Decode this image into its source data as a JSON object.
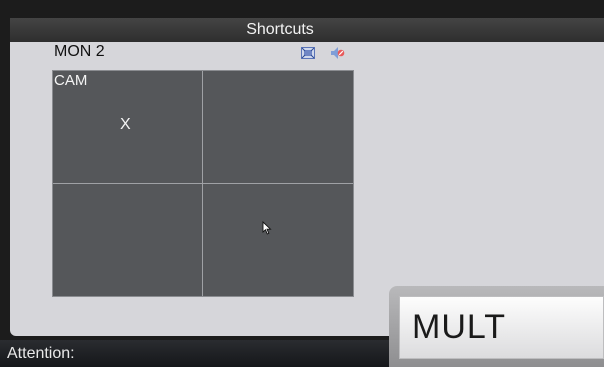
{
  "window": {
    "title": "Shortcuts"
  },
  "monitor": {
    "label": "MON 2"
  },
  "icons": {
    "fullscreen": "fullscreen-icon",
    "mute": "mute-icon",
    "cursor": "pointer-cursor-icon"
  },
  "grid": {
    "cells": [
      {
        "label": "CAM",
        "mark": "X"
      },
      {
        "label": "",
        "mark": ""
      },
      {
        "label": "",
        "mark": ""
      },
      {
        "label": "",
        "mark": ""
      }
    ]
  },
  "status": {
    "attention_label": "Attention:"
  },
  "buttons": {
    "mult_label": "MULT"
  },
  "colors": {
    "panel": "#d6d6da",
    "grid": "#55575a",
    "titlebar": "#3a3a3a"
  }
}
